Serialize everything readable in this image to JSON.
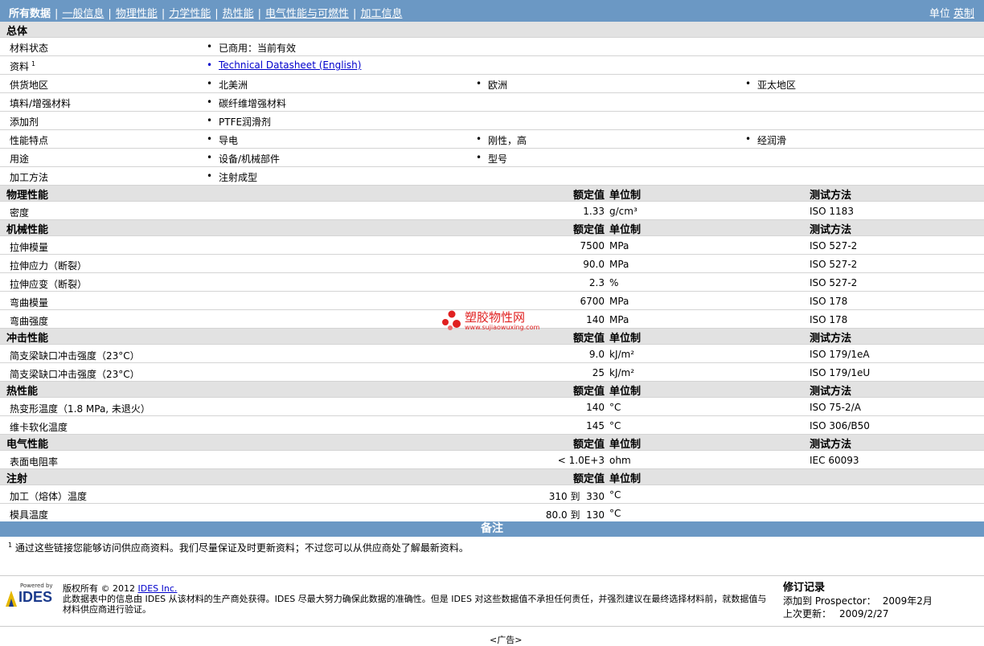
{
  "nav": {
    "tabs": [
      "所有数据",
      "一般信息",
      "物理性能",
      "力学性能",
      "热性能",
      "电气性能与可燃性",
      "加工信息"
    ],
    "unit_label": "单位",
    "unit_value": "英制"
  },
  "general": {
    "title": "总体",
    "status": {
      "label": "材料状态",
      "value": "已商用：当前有效"
    },
    "resources": {
      "label": "资料",
      "sup": "1",
      "link": "Technical Datasheet (English)"
    },
    "regions": {
      "label": "供货地区",
      "items": [
        "北美洲",
        "欧洲",
        "亚太地区"
      ]
    },
    "filler": {
      "label": "填料/增强材料",
      "items": [
        "碳纤维增强材料"
      ]
    },
    "additive": {
      "label": "添加剂",
      "items": [
        "PTFE润滑剂"
      ]
    },
    "features": {
      "label": "性能特点",
      "items": [
        "导电",
        "刚性，高",
        "经润滑"
      ]
    },
    "uses": {
      "label": "用途",
      "items": [
        "设备/机械部件",
        "型号"
      ]
    },
    "method": {
      "label": "加工方法",
      "items": [
        "注射成型"
      ]
    }
  },
  "columns": {
    "nominal": "额定值",
    "unit": "单位制",
    "test": "测试方法"
  },
  "sections": [
    {
      "title": "物理性能",
      "rows": [
        {
          "name": "密度",
          "value": "1.33",
          "unit": "g/cm³",
          "test": "ISO 1183"
        }
      ]
    },
    {
      "title": "机械性能",
      "rows": [
        {
          "name": "拉伸模量",
          "value": "7500",
          "unit": "MPa",
          "test": "ISO 527-2"
        },
        {
          "name": "拉伸应力（断裂）",
          "value": "90.0",
          "unit": "MPa",
          "test": "ISO 527-2"
        },
        {
          "name": "拉伸应变（断裂）",
          "value": "2.3",
          "unit": "%",
          "test": "ISO 527-2"
        },
        {
          "name": "弯曲模量",
          "value": "6700",
          "unit": "MPa",
          "test": "ISO 178"
        },
        {
          "name": "弯曲强度",
          "value": "140",
          "unit": "MPa",
          "test": "ISO 178"
        }
      ]
    },
    {
      "title": "冲击性能",
      "rows": [
        {
          "name": "简支梁缺口冲击强度（23°C）",
          "value": "9.0",
          "unit": "kJ/m²",
          "test": "ISO 179/1eA"
        },
        {
          "name": "简支梁缺口冲击强度（23°C）",
          "value": "25",
          "unit": "kJ/m²",
          "test": "ISO 179/1eU"
        }
      ]
    },
    {
      "title": "热性能",
      "rows": [
        {
          "name": "热变形温度（1.8 MPa, 未退火）",
          "value": "140",
          "unit": "°C",
          "test": "ISO 75-2/A"
        },
        {
          "name": "维卡软化温度",
          "value": "145",
          "unit": "°C",
          "test": "ISO 306/B50"
        }
      ]
    },
    {
      "title": "电气性能",
      "rows": [
        {
          "name": "表面电阻率",
          "value": "< 1.0E+3",
          "unit": "ohm",
          "test": "IEC 60093"
        }
      ]
    },
    {
      "title": "注射",
      "rows": [
        {
          "name": "加工（熔体）温度",
          "value": "310 到  330",
          "unit": "°C",
          "test": ""
        },
        {
          "name": "模具温度",
          "value": "80.0 到  130",
          "unit": "°C",
          "test": ""
        }
      ]
    }
  ],
  "notes": {
    "title": "备注",
    "sup": "1",
    "text": "通过这些链接您能够访问供应商资料。我们尽量保证及时更新资料；不过您可以从供应商处了解最新资料。"
  },
  "footer": {
    "logo_top": "Powered by",
    "logo_main": "IDES",
    "copyright_prefix": "版权所有 © 2012",
    "copyright_link": "IDES Inc.",
    "disclaimer": "此数据表中的信息由 IDES 从该材料的生产商处获得。IDES 尽最大努力确保此数据的准确性。但是 IDES 对这些数据值不承担任何责任，并强烈建议在最终选择材料前，就数据值与材料供应商进行验证。",
    "rev_title": "修订记录",
    "added_label": "添加到 Prospector：",
    "added_value": "2009年2月",
    "updated_label": "上次更新：",
    "updated_value": "2009/2/27"
  },
  "watermark": {
    "title": "塑胶物性网",
    "url": "www.sujiaowuxing.com"
  },
  "ad": "<广告>",
  "colors": {
    "nav": "#6b98c4",
    "header": "#e2e2e2",
    "brand": "#e02020"
  }
}
